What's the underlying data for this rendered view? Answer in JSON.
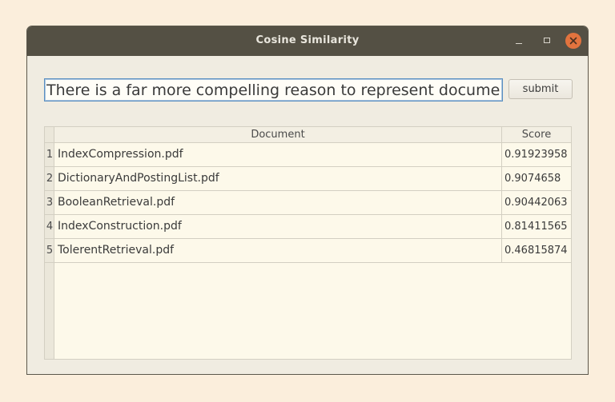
{
  "window": {
    "title": "Cosine Similarity"
  },
  "query": {
    "value": "There is a far more compelling reason to represent documents as vectors"
  },
  "submit_label": "submit",
  "table": {
    "columns": [
      "Document",
      "Score"
    ],
    "rows": [
      {
        "index": "1",
        "document": "IndexCompression.pdf",
        "score": "0.91923958"
      },
      {
        "index": "2",
        "document": "DictionaryAndPostingList.pdf",
        "score": "0.9074658"
      },
      {
        "index": "3",
        "document": "BooleanRetrieval.pdf",
        "score": "0.90442063"
      },
      {
        "index": "4",
        "document": "IndexConstruction.pdf",
        "score": "0.81411565"
      },
      {
        "index": "5",
        "document": "TolerentRetrieval.pdf",
        "score": "0.46815874"
      }
    ]
  },
  "icons": {
    "minimize": "minimize-icon",
    "maximize": "maximize-icon",
    "close": "close-icon"
  },
  "colors": {
    "titlebar": "#545044",
    "close_button": "#e2733e",
    "background": "#fbeedc",
    "window_body": "#f0ece1",
    "table_body": "#fdf9ea"
  }
}
